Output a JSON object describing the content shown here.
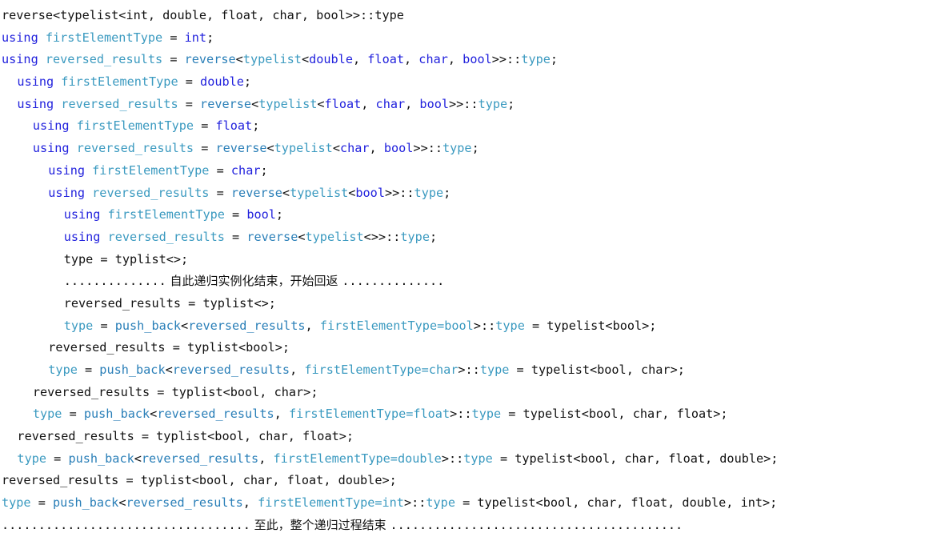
{
  "document": {
    "kind": "code-listing",
    "language": "C++",
    "background_color": "#ffffff",
    "colors": {
      "plain": "#111111",
      "keyword": "#2222dd",
      "identifier": "#3b9ac0",
      "function": "#2a7fb8"
    }
  },
  "lines": [
    {
      "index": 1,
      "indent": 0,
      "text": "reverse<typelist<int, double, float, char, bool>>::type",
      "tokens": [
        {
          "t": "reverse<typelist<int, double, float, char, bool>>::type",
          "c": "plain"
        }
      ]
    },
    {
      "index": 2,
      "indent": 0,
      "text": "using firstElementType = int;",
      "tokens": [
        {
          "t": "using",
          "c": "keyword"
        },
        {
          "t": " ",
          "c": "plain"
        },
        {
          "t": "firstElementType",
          "c": "identifier"
        },
        {
          "t": " = ",
          "c": "plain"
        },
        {
          "t": "int",
          "c": "keyword"
        },
        {
          "t": ";",
          "c": "plain"
        }
      ]
    },
    {
      "index": 3,
      "indent": 0,
      "text": "using reversed_results = reverse<typelist<double, float, char, bool>>::type;",
      "tokens": [
        {
          "t": "using",
          "c": "keyword"
        },
        {
          "t": " ",
          "c": "plain"
        },
        {
          "t": "reversed_results",
          "c": "identifier"
        },
        {
          "t": " = ",
          "c": "plain"
        },
        {
          "t": "reverse",
          "c": "function"
        },
        {
          "t": "<",
          "c": "plain"
        },
        {
          "t": "typelist",
          "c": "identifier"
        },
        {
          "t": "<",
          "c": "plain"
        },
        {
          "t": "double",
          "c": "keyword"
        },
        {
          "t": ", ",
          "c": "plain"
        },
        {
          "t": "float",
          "c": "keyword"
        },
        {
          "t": ", ",
          "c": "plain"
        },
        {
          "t": "char",
          "c": "keyword"
        },
        {
          "t": ", ",
          "c": "plain"
        },
        {
          "t": "bool",
          "c": "keyword"
        },
        {
          "t": ">>::",
          "c": "plain"
        },
        {
          "t": "type",
          "c": "identifier"
        },
        {
          "t": ";",
          "c": "plain"
        }
      ]
    },
    {
      "index": 4,
      "indent": 2,
      "text": "using firstElementType = double;",
      "tokens": [
        {
          "t": "using",
          "c": "keyword"
        },
        {
          "t": " ",
          "c": "plain"
        },
        {
          "t": "firstElementType",
          "c": "identifier"
        },
        {
          "t": " = ",
          "c": "plain"
        },
        {
          "t": "double",
          "c": "keyword"
        },
        {
          "t": ";",
          "c": "plain"
        }
      ]
    },
    {
      "index": 5,
      "indent": 2,
      "text": "using reversed_results = reverse<typelist<float, char, bool>>::type;",
      "tokens": [
        {
          "t": "using",
          "c": "keyword"
        },
        {
          "t": " ",
          "c": "plain"
        },
        {
          "t": "reversed_results",
          "c": "identifier"
        },
        {
          "t": " = ",
          "c": "plain"
        },
        {
          "t": "reverse",
          "c": "function"
        },
        {
          "t": "<",
          "c": "plain"
        },
        {
          "t": "typelist",
          "c": "identifier"
        },
        {
          "t": "<",
          "c": "plain"
        },
        {
          "t": "float",
          "c": "keyword"
        },
        {
          "t": ", ",
          "c": "plain"
        },
        {
          "t": "char",
          "c": "keyword"
        },
        {
          "t": ", ",
          "c": "plain"
        },
        {
          "t": "bool",
          "c": "keyword"
        },
        {
          "t": ">>::",
          "c": "plain"
        },
        {
          "t": "type",
          "c": "identifier"
        },
        {
          "t": ";",
          "c": "plain"
        }
      ]
    },
    {
      "index": 6,
      "indent": 4,
      "text": "using firstElementType = float;",
      "tokens": [
        {
          "t": "using",
          "c": "keyword"
        },
        {
          "t": " ",
          "c": "plain"
        },
        {
          "t": "firstElementType",
          "c": "identifier"
        },
        {
          "t": " = ",
          "c": "plain"
        },
        {
          "t": "float",
          "c": "keyword"
        },
        {
          "t": ";",
          "c": "plain"
        }
      ]
    },
    {
      "index": 7,
      "indent": 4,
      "text": "using reversed_results = reverse<typelist<char, bool>>::type;",
      "tokens": [
        {
          "t": "using",
          "c": "keyword"
        },
        {
          "t": " ",
          "c": "plain"
        },
        {
          "t": "reversed_results",
          "c": "identifier"
        },
        {
          "t": " = ",
          "c": "plain"
        },
        {
          "t": "reverse",
          "c": "function"
        },
        {
          "t": "<",
          "c": "plain"
        },
        {
          "t": "typelist",
          "c": "identifier"
        },
        {
          "t": "<",
          "c": "plain"
        },
        {
          "t": "char",
          "c": "keyword"
        },
        {
          "t": ", ",
          "c": "plain"
        },
        {
          "t": "bool",
          "c": "keyword"
        },
        {
          "t": ">>::",
          "c": "plain"
        },
        {
          "t": "type",
          "c": "identifier"
        },
        {
          "t": ";",
          "c": "plain"
        }
      ]
    },
    {
      "index": 8,
      "indent": 6,
      "text": "using firstElementType = char;",
      "tokens": [
        {
          "t": "using",
          "c": "keyword"
        },
        {
          "t": " ",
          "c": "plain"
        },
        {
          "t": "firstElementType",
          "c": "identifier"
        },
        {
          "t": " = ",
          "c": "plain"
        },
        {
          "t": "char",
          "c": "keyword"
        },
        {
          "t": ";",
          "c": "plain"
        }
      ]
    },
    {
      "index": 9,
      "indent": 6,
      "text": "using reversed_results = reverse<typelist<bool>>::type;",
      "tokens": [
        {
          "t": "using",
          "c": "keyword"
        },
        {
          "t": " ",
          "c": "plain"
        },
        {
          "t": "reversed_results",
          "c": "identifier"
        },
        {
          "t": " = ",
          "c": "plain"
        },
        {
          "t": "reverse",
          "c": "function"
        },
        {
          "t": "<",
          "c": "plain"
        },
        {
          "t": "typelist",
          "c": "identifier"
        },
        {
          "t": "<",
          "c": "plain"
        },
        {
          "t": "bool",
          "c": "keyword"
        },
        {
          "t": ">>::",
          "c": "plain"
        },
        {
          "t": "type",
          "c": "identifier"
        },
        {
          "t": ";",
          "c": "plain"
        }
      ]
    },
    {
      "index": 10,
      "indent": 8,
      "text": "using firstElementType = bool;",
      "tokens": [
        {
          "t": "using",
          "c": "keyword"
        },
        {
          "t": " ",
          "c": "plain"
        },
        {
          "t": "firstElementType",
          "c": "identifier"
        },
        {
          "t": " = ",
          "c": "plain"
        },
        {
          "t": "bool",
          "c": "keyword"
        },
        {
          "t": ";",
          "c": "plain"
        }
      ]
    },
    {
      "index": 11,
      "indent": 8,
      "text": "using reversed_results = reverse<typelist<>>::type;",
      "tokens": [
        {
          "t": "using",
          "c": "keyword"
        },
        {
          "t": " ",
          "c": "plain"
        },
        {
          "t": "reversed_results",
          "c": "identifier"
        },
        {
          "t": " = ",
          "c": "plain"
        },
        {
          "t": "reverse",
          "c": "function"
        },
        {
          "t": "<",
          "c": "plain"
        },
        {
          "t": "typelist",
          "c": "identifier"
        },
        {
          "t": "<>>::",
          "c": "plain"
        },
        {
          "t": "type",
          "c": "identifier"
        },
        {
          "t": ";",
          "c": "plain"
        }
      ]
    },
    {
      "index": 12,
      "indent": 8,
      "text": "type = typlist<>;",
      "tokens": [
        {
          "t": "type = typlist<>;",
          "c": "plain"
        }
      ]
    },
    {
      "index": 13,
      "indent": 8,
      "text": ".............. 自此递归实例化结束，开始回返 ..............",
      "annotation": "自此递归实例化结束，开始回返",
      "tokens": [
        {
          "t": "..............",
          "c": "plain"
        },
        {
          "t": " 自此递归实例化结束，开始回返 ",
          "c": "plain",
          "cjk": true
        },
        {
          "t": "..............",
          "c": "plain"
        }
      ]
    },
    {
      "index": 14,
      "indent": 8,
      "text": "reversed_results = typlist<>;",
      "tokens": [
        {
          "t": "reversed_results = typlist<>;",
          "c": "plain"
        }
      ]
    },
    {
      "index": 15,
      "indent": 8,
      "text": "type = push_back<reversed_results, firstElementType=bool>::type = typelist<bool>;",
      "tokens": [
        {
          "t": "type",
          "c": "identifier"
        },
        {
          "t": " = ",
          "c": "plain"
        },
        {
          "t": "push_back",
          "c": "function"
        },
        {
          "t": "<",
          "c": "plain"
        },
        {
          "t": "reversed_results",
          "c": "function"
        },
        {
          "t": ", ",
          "c": "plain"
        },
        {
          "t": "firstElementType=bool",
          "c": "identifier"
        },
        {
          "t": ">::",
          "c": "plain"
        },
        {
          "t": "type",
          "c": "identifier"
        },
        {
          "t": " = typelist<bool>;",
          "c": "plain"
        }
      ]
    },
    {
      "index": 16,
      "indent": 6,
      "text": "reversed_results = typlist<bool>;",
      "tokens": [
        {
          "t": "reversed_results = typlist<bool>;",
          "c": "plain"
        }
      ]
    },
    {
      "index": 17,
      "indent": 6,
      "text": "type = push_back<reversed_results, firstElementType=char>::type = typelist<bool, char>;",
      "tokens": [
        {
          "t": "type",
          "c": "identifier"
        },
        {
          "t": " = ",
          "c": "plain"
        },
        {
          "t": "push_back",
          "c": "function"
        },
        {
          "t": "<",
          "c": "plain"
        },
        {
          "t": "reversed_results",
          "c": "function"
        },
        {
          "t": ", ",
          "c": "plain"
        },
        {
          "t": "firstElementType=char",
          "c": "identifier"
        },
        {
          "t": ">::",
          "c": "plain"
        },
        {
          "t": "type",
          "c": "identifier"
        },
        {
          "t": " = typelist<bool, char>;",
          "c": "plain"
        }
      ]
    },
    {
      "index": 18,
      "indent": 4,
      "text": "reversed_results = typlist<bool, char>;",
      "tokens": [
        {
          "t": "reversed_results = typlist<bool, char>;",
          "c": "plain"
        }
      ]
    },
    {
      "index": 19,
      "indent": 4,
      "text": "type = push_back<reversed_results, firstElementType=float>::type = typelist<bool, char, float>;",
      "tokens": [
        {
          "t": "type",
          "c": "identifier"
        },
        {
          "t": " = ",
          "c": "plain"
        },
        {
          "t": "push_back",
          "c": "function"
        },
        {
          "t": "<",
          "c": "plain"
        },
        {
          "t": "reversed_results",
          "c": "function"
        },
        {
          "t": ", ",
          "c": "plain"
        },
        {
          "t": "firstElementType=float",
          "c": "identifier"
        },
        {
          "t": ">::",
          "c": "plain"
        },
        {
          "t": "type",
          "c": "identifier"
        },
        {
          "t": " = typelist<bool, char, float>;",
          "c": "plain"
        }
      ]
    },
    {
      "index": 20,
      "indent": 2,
      "text": "reversed_results = typlist<bool, char, float>;",
      "tokens": [
        {
          "t": "reversed_results = typlist<bool, char, float>;",
          "c": "plain"
        }
      ]
    },
    {
      "index": 21,
      "indent": 2,
      "text": "type = push_back<reversed_results, firstElementType=double>::type = typelist<bool, char, float, double>;",
      "tokens": [
        {
          "t": "type",
          "c": "identifier"
        },
        {
          "t": " = ",
          "c": "plain"
        },
        {
          "t": "push_back",
          "c": "function"
        },
        {
          "t": "<",
          "c": "plain"
        },
        {
          "t": "reversed_results",
          "c": "function"
        },
        {
          "t": ", ",
          "c": "plain"
        },
        {
          "t": "firstElementType=double",
          "c": "identifier"
        },
        {
          "t": ">::",
          "c": "plain"
        },
        {
          "t": "type",
          "c": "identifier"
        },
        {
          "t": " = typelist<bool, char, float, double>;",
          "c": "plain"
        }
      ]
    },
    {
      "index": 22,
      "indent": 0,
      "text": "reversed_results = typlist<bool, char, float, double>;",
      "tokens": [
        {
          "t": "reversed_results = typlist<bool, char, float, double>;",
          "c": "plain"
        }
      ]
    },
    {
      "index": 23,
      "indent": 0,
      "text": "type = push_back<reversed_results, firstElementType=int>::type = typelist<bool, char, float, double, int>;",
      "tokens": [
        {
          "t": "type",
          "c": "identifier"
        },
        {
          "t": " = ",
          "c": "plain"
        },
        {
          "t": "push_back",
          "c": "function"
        },
        {
          "t": "<",
          "c": "plain"
        },
        {
          "t": "reversed_results",
          "c": "function"
        },
        {
          "t": ", ",
          "c": "plain"
        },
        {
          "t": "firstElementType=int",
          "c": "identifier"
        },
        {
          "t": ">::",
          "c": "plain"
        },
        {
          "t": "type",
          "c": "identifier"
        },
        {
          "t": " = typelist<bool, char, float, double, int>;",
          "c": "plain"
        }
      ]
    },
    {
      "index": 24,
      "indent": 0,
      "text": ".................................. 至此，整个递归过程结束 ........................................",
      "annotation": "至此，整个递归过程结束",
      "tokens": [
        {
          "t": "..................................",
          "c": "plain"
        },
        {
          "t": " 至此，整个递归过程结束 ",
          "c": "plain",
          "cjk": true
        },
        {
          "t": "........................................",
          "c": "plain"
        }
      ]
    }
  ]
}
